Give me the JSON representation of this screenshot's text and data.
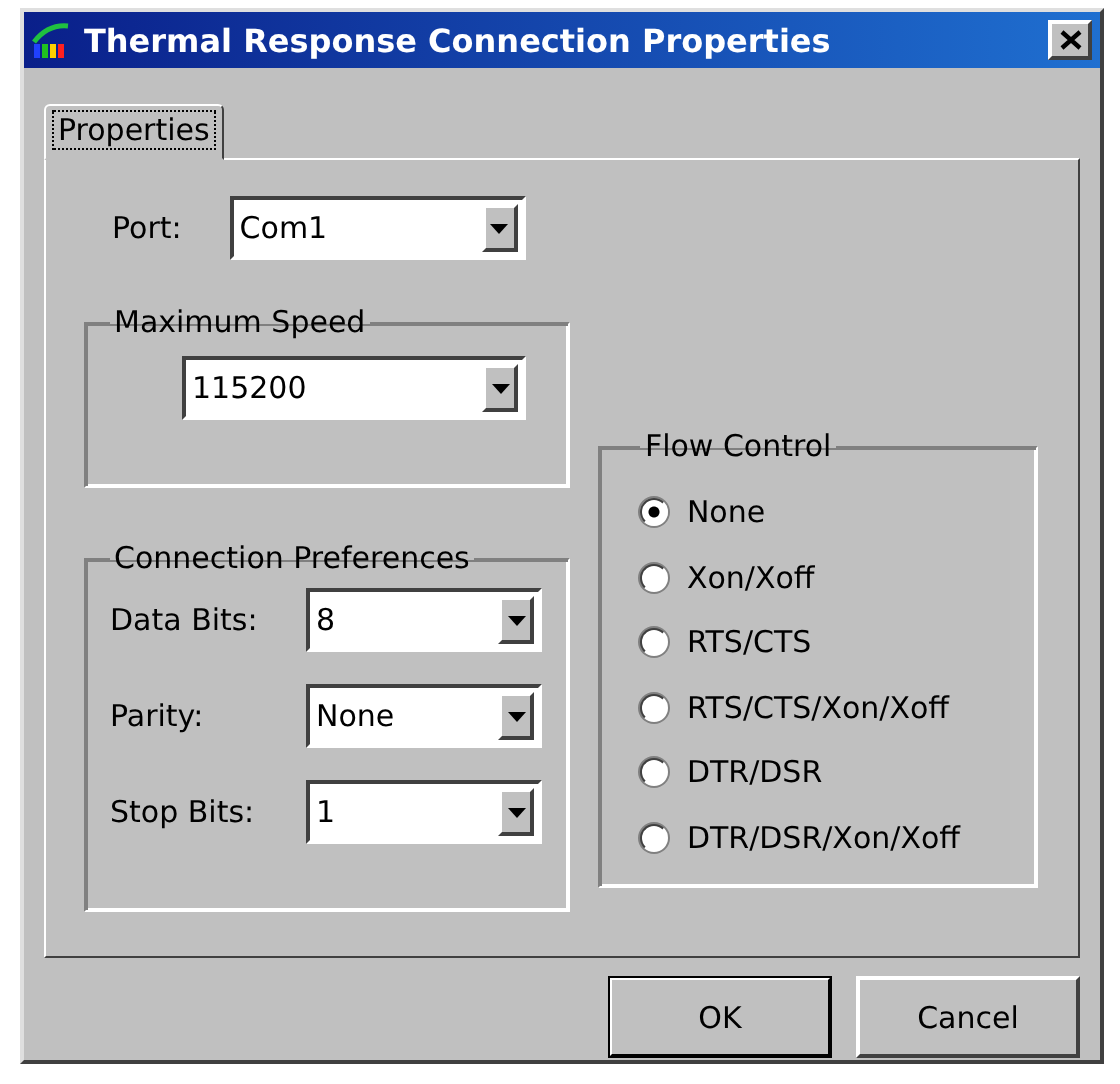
{
  "window": {
    "title": "Thermal Response Connection Properties"
  },
  "tabs": [
    {
      "label": "Properties",
      "selected": true
    }
  ],
  "port": {
    "label": "Port:",
    "value": "Com1"
  },
  "maximum_speed": {
    "title": "Maximum Speed",
    "value": "115200"
  },
  "connection_preferences": {
    "title": "Connection Preferences",
    "fields": [
      {
        "label": "Data Bits:",
        "value": "8"
      },
      {
        "label": "Parity:",
        "value": "None"
      },
      {
        "label": "Stop Bits:",
        "value": "1"
      }
    ]
  },
  "flow_control": {
    "title": "Flow Control",
    "options": [
      {
        "label": "None",
        "selected": true
      },
      {
        "label": "Xon/Xoff",
        "selected": false
      },
      {
        "label": "RTS/CTS",
        "selected": false
      },
      {
        "label": "RTS/CTS/Xon/Xoff",
        "selected": false
      },
      {
        "label": "DTR/DSR",
        "selected": false
      },
      {
        "label": "DTR/DSR/Xon/Xoff",
        "selected": false
      }
    ]
  },
  "buttons": [
    {
      "label": "OK",
      "default": true
    },
    {
      "label": "Cancel",
      "default": false
    }
  ]
}
